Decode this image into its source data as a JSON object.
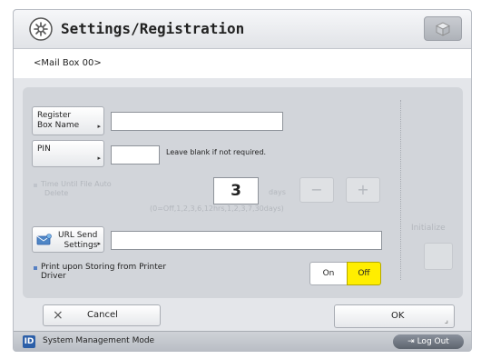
{
  "window": {
    "title": "Settings/Registration",
    "subheader": "<Mail Box 00>"
  },
  "form": {
    "register_box_name": {
      "label_line1": "Register",
      "label_line2": "Box Name",
      "value": ""
    },
    "pin": {
      "label": "PIN",
      "value": "",
      "hint": "Leave blank if not required."
    },
    "auto_delete": {
      "label_line1": "Time Until File Auto",
      "label_line2": "Delete",
      "value": "3",
      "unit": "days",
      "range_hint": "(0=Off,1,2,3,6,12hrs,1,2,3,7,30days)",
      "minus": "−",
      "plus": "+"
    },
    "url_send": {
      "label_line1": "URL Send",
      "label_line2": "Settings",
      "value": ""
    },
    "print_upon_storing": {
      "label_line1": "Print upon Storing from Printer",
      "label_line2": "Driver",
      "on_label": "On",
      "off_label": "Off",
      "selected": "Off"
    },
    "initialize_label": "Initialize"
  },
  "actions": {
    "cancel_label": "Cancel",
    "ok_label": "OK"
  },
  "status": {
    "mode_icon": "ID",
    "mode_text": "System Management Mode",
    "logout_label": "Log Out"
  },
  "colors": {
    "accent_selected": "#ffee00",
    "bullet": "#5680c3"
  }
}
